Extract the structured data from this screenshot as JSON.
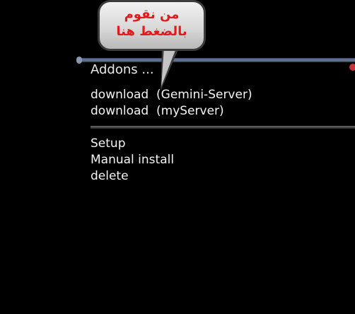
{
  "callout": {
    "line1": "من نقوم",
    "line2": "بالضغط هنا"
  },
  "dialog": {
    "title": "Addons ..."
  },
  "menu": {
    "download_items": [
      {
        "label": "download  (Gemini-Server)"
      },
      {
        "label": "download  (myServer)"
      }
    ],
    "actions": [
      {
        "label": "Setup"
      },
      {
        "label": "Manual install"
      },
      {
        "label": "delete"
      }
    ]
  },
  "colors": {
    "background": "#000000",
    "text": "#f4f4f4",
    "callout_text": "#e11b1b",
    "accent_dot": "#c8323c"
  }
}
